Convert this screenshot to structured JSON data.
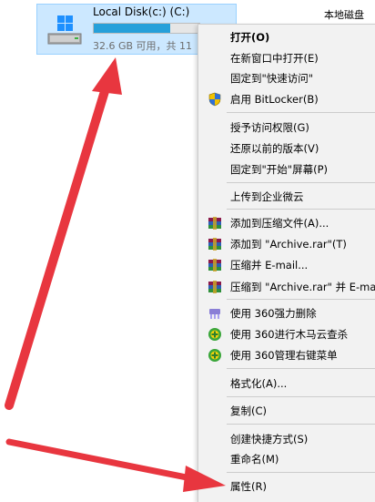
{
  "explorer": {
    "drive_name": "Local Disk(c:) (C:)",
    "drive_space": "32.6 GB 可用，共 11",
    "drive_fill_fraction": 0.72,
    "side_label": "本地磁盘"
  },
  "menu": {
    "open": "打开(O)",
    "open_new_window": "在新窗口中打开(E)",
    "pin_quick_access": "固定到\"快速访问\"",
    "bitlocker": "启用 BitLocker(B)",
    "grant_access": "授予访问权限(G)",
    "restore_versions": "还原以前的版本(V)",
    "pin_start": "固定到\"开始\"屏幕(P)",
    "upload_wecloud": "上传到企业微云",
    "add_to_archive": "添加到压缩文件(A)...",
    "add_to_archive_rar": "添加到 \"Archive.rar\"(T)",
    "compress_email": "压缩并 E-mail...",
    "compress_rar_email": "压缩到 \"Archive.rar\" 并 E-ma",
    "delete_360": "使用 360强力删除",
    "scan_360": "使用 360进行木马云查杀",
    "manage_360": "使用 360管理右键菜单",
    "format": "格式化(A)...",
    "copy": "复制(C)",
    "create_shortcut": "创建快捷方式(S)",
    "rename": "重命名(M)",
    "properties": "属性(R)"
  },
  "colors": {
    "arrow_red": "#e8363f",
    "selection_bg": "#cce8ff",
    "progress_blue": "#26a0da",
    "menu_bg": "#f2f2f2"
  },
  "icons": {
    "drive": "windows-drive-icon",
    "bitlocker": "shield-icon",
    "winrar": "winrar-books-icon",
    "shredder_360": "360-shredder-icon",
    "shield_360": "360-shield-icon"
  }
}
